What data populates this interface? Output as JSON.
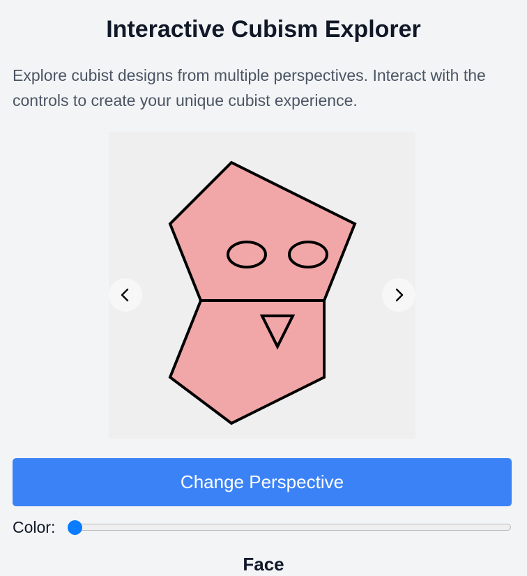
{
  "header": {
    "title": "Interactive Cubism Explorer",
    "description": "Explore cubist designs from multiple perspectives. Interact with the controls to create your unique cubist experience."
  },
  "canvas": {
    "background_color": "#efefef",
    "fill_color": "#f1a7a7",
    "stroke_color": "#000000",
    "prev_icon": "chevron-left-icon",
    "next_icon": "chevron-right-icon"
  },
  "controls": {
    "perspective_button_label": "Change Perspective",
    "button_color": "#3b82f6",
    "color_label": "Color:",
    "color_slider_value": 0,
    "slider_accent": "#0a7cff"
  },
  "section": {
    "heading": "Face"
  }
}
